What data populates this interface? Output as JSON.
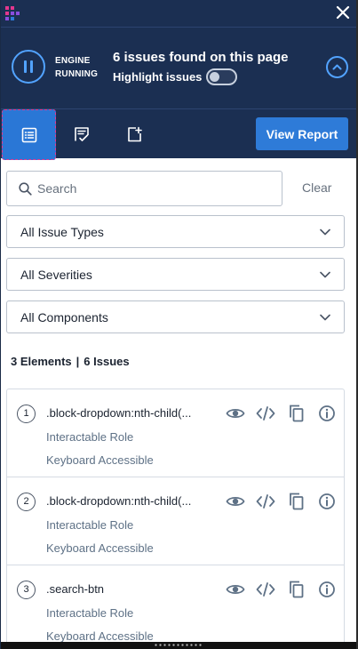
{
  "header": {
    "engine_state_line1": "ENGINE",
    "engine_state_line2": "RUNNING",
    "issues_found": "6 issues found on this page",
    "highlight_label": "Highlight issues",
    "highlight_enabled": false
  },
  "tabs": [
    {
      "icon": "list-icon",
      "active": true
    },
    {
      "icon": "checklist-icon",
      "active": false
    },
    {
      "icon": "export-icon",
      "active": false
    }
  ],
  "view_report_label": "View Report",
  "search": {
    "placeholder": "Search",
    "value": "",
    "clear_label": "Clear"
  },
  "filters": {
    "issue_types": "All Issue Types",
    "severities": "All Severities",
    "components": "All Components"
  },
  "summary": {
    "elements": "3 Elements",
    "separator": "|",
    "issues": "6 Issues"
  },
  "results": [
    {
      "number": "1",
      "selector": ".block-dropdown:nth-child(...",
      "rules": [
        "Interactable Role",
        "Keyboard Accessible"
      ]
    },
    {
      "number": "2",
      "selector": ".block-dropdown:nth-child(...",
      "rules": [
        "Interactable Role",
        "Keyboard Accessible"
      ]
    },
    {
      "number": "3",
      "selector": ".search-btn",
      "rules": [
        "Interactable Role",
        "Keyboard Accessible"
      ]
    }
  ],
  "colors": {
    "header_bg": "#1b2f52",
    "accent": "#2e7bd8",
    "accent_light": "#52a3ff",
    "active_tab_outline": "#e4378e",
    "action_icon": "#5e7186"
  }
}
